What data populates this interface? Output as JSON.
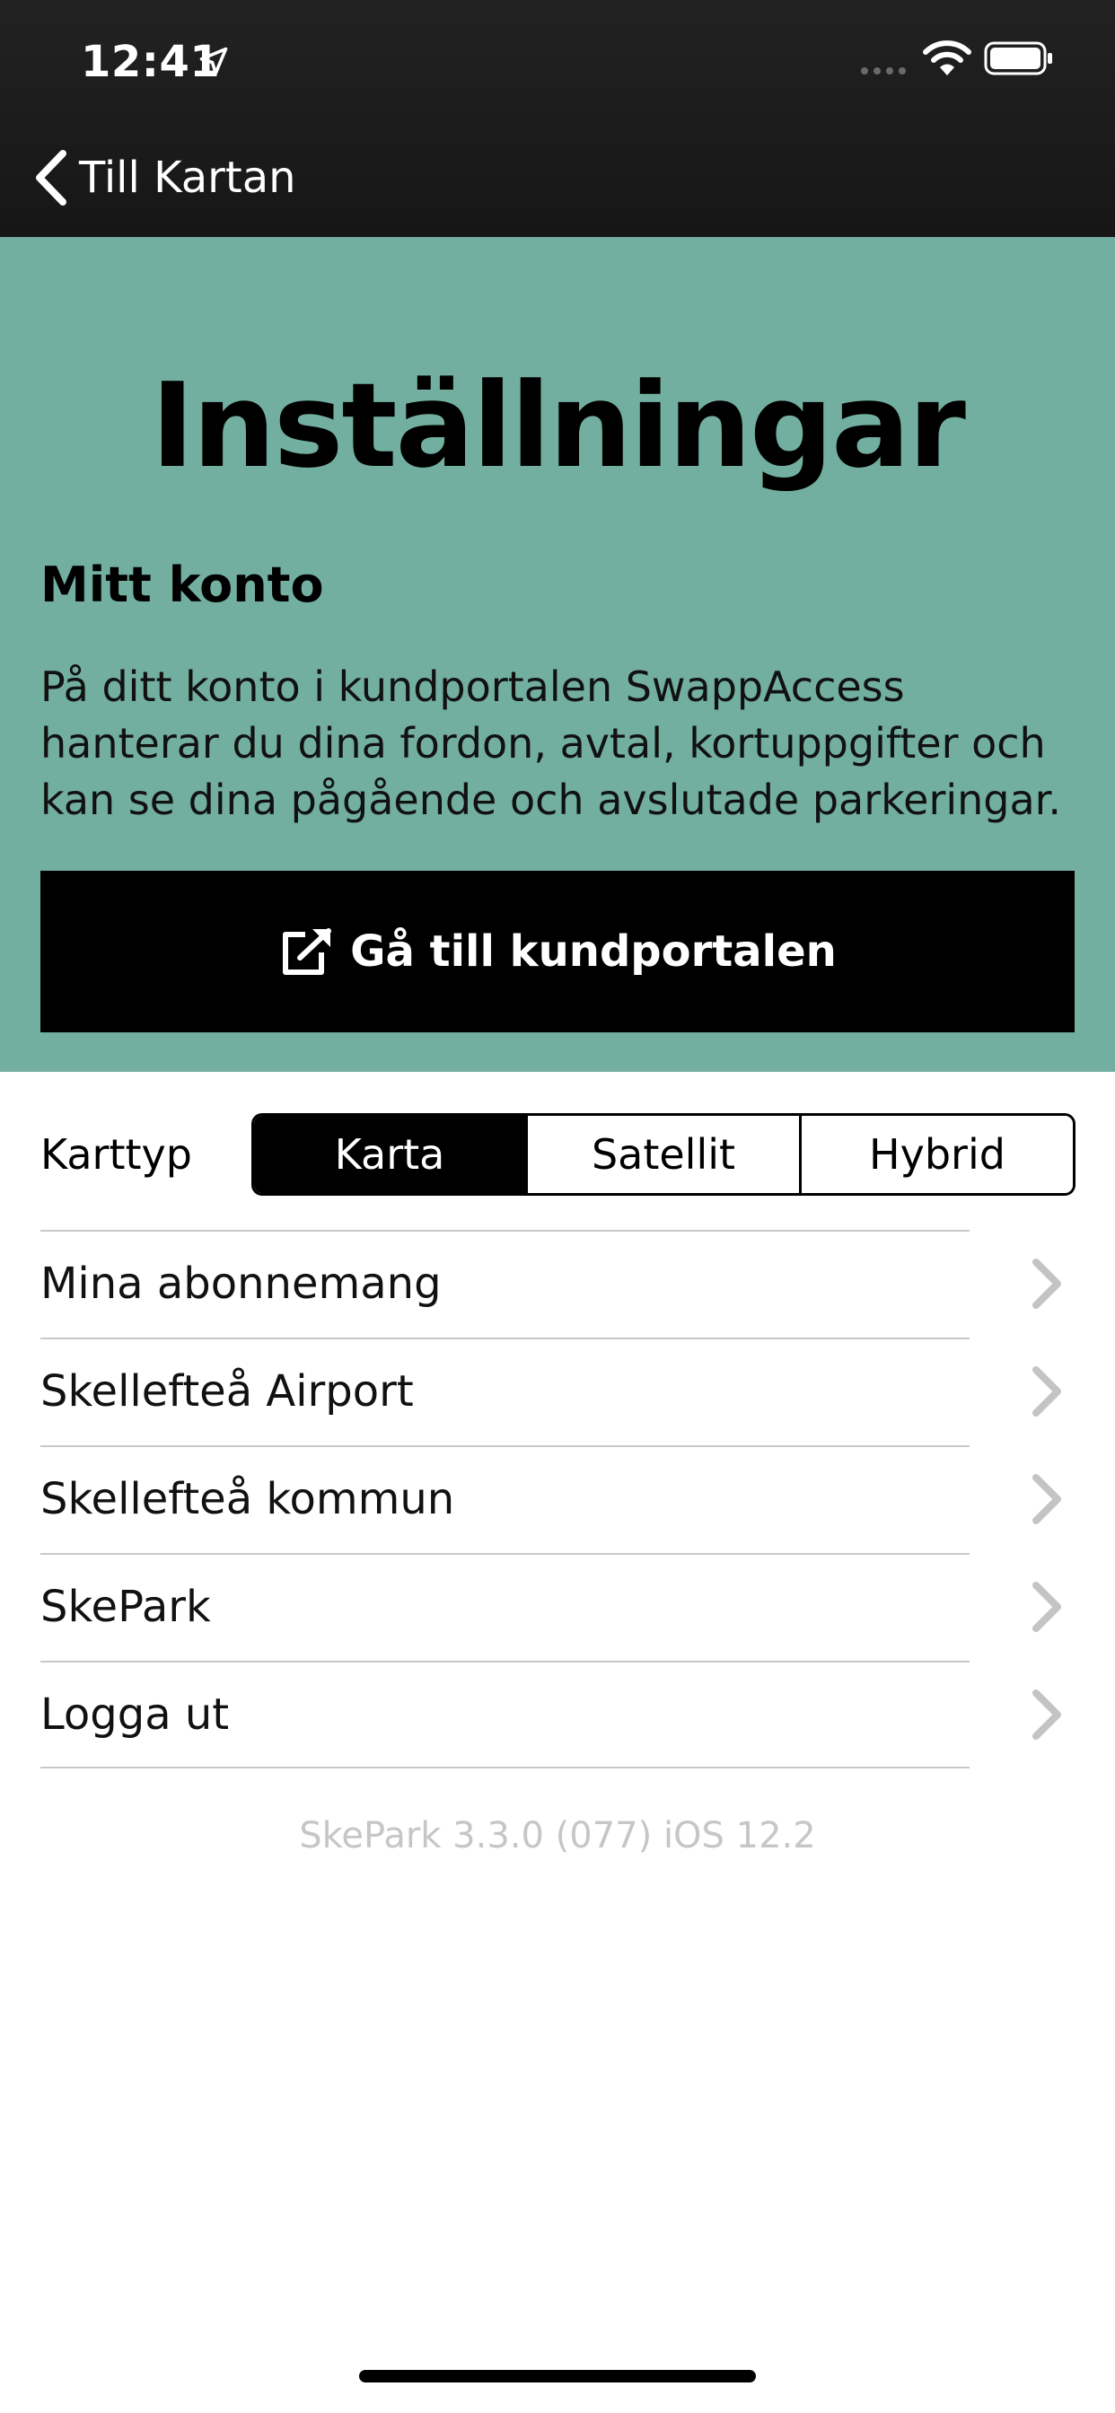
{
  "status_bar": {
    "time": "12:41",
    "icons": [
      "location-arrow-icon",
      "cellular-signal-icon",
      "wifi-icon",
      "battery-icon"
    ]
  },
  "nav": {
    "back_label": "Till Kartan",
    "back_icon": "chevron-left-icon"
  },
  "hero": {
    "title": "Inställningar",
    "section_title": "Mitt konto",
    "description": "På ditt konto i kundportalen SwappAccess hanterar du dina fordon, avtal, kortuppgifter och kan se dina pågående och avslutade parkeringar.",
    "portal_button_label": "Gå till kundportalen",
    "portal_button_icon": "external-link-icon",
    "background_color": "#72afa0"
  },
  "map_type": {
    "label": "Karttyp",
    "options": [
      "Karta",
      "Satellit",
      "Hybrid"
    ],
    "selected": "Karta"
  },
  "list": {
    "items": [
      {
        "label": "Mina abonnemang"
      },
      {
        "label": "Skellefteå Airport"
      },
      {
        "label": "Skellefteå kommun"
      },
      {
        "label": "SkePark"
      },
      {
        "label": "Logga ut"
      }
    ],
    "chevron_icon": "chevron-right-icon"
  },
  "footer": {
    "version": "SkePark 3.3.0 (077) iOS 12.2"
  }
}
